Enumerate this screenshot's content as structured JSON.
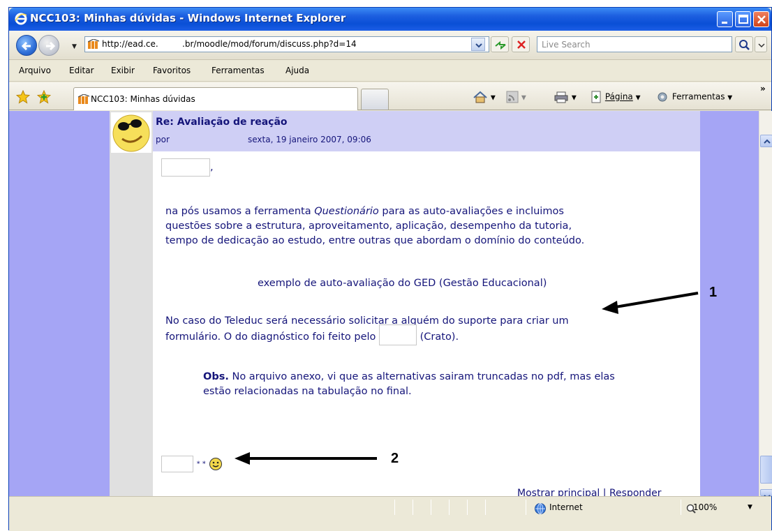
{
  "window": {
    "title": "NCC103: Minhas dúvidas - Windows Internet Explorer"
  },
  "address_bar": {
    "url": "http://ead.ce.         .br/moodle/mod/forum/discuss.php?d=14",
    "search_placeholder": "Live Search"
  },
  "menu": {
    "items": [
      "Arquivo",
      "Editar",
      "Exibir",
      "Favoritos",
      "Ferramentas",
      "Ajuda"
    ]
  },
  "tabs": {
    "active_tab": "NCC103: Minhas dúvidas",
    "page_label": "Página",
    "tools_label": "Ferramentas"
  },
  "post": {
    "subject": "Re: Avaliação de reação",
    "by_prefix": "por",
    "date": "sexta, 19 janeiro 2007, 09:06",
    "greeting_suffix": ",",
    "para1_a": "na pós usamos a ferramenta ",
    "para1_em": "Questionário",
    "para1_b": " para as auto-avaliações e incluimos",
    "para1_line2": "questões sobre a estrutura, aproveitamento, aplicação, desempenho da tutoria,",
    "para1_line3": "tempo de dedicação ao estudo, entre outras que abordam o domínio do conteúdo.",
    "link": "exemplo de auto-avaliação do GED (Gestão Educacional)",
    "para2_line1": "No caso do Teleduc será necessário solicitar a alguém do suporte para criar um",
    "para2_line2a": "formulário. O do diagnóstico foi feito pelo ",
    "para2_line2b": " (Crato).",
    "obs_label": "Obs.",
    "obs_line1": " No arquivo anexo, vi que as alternativas sairam truncadas no pdf, mas elas",
    "obs_line2": "estão relacionadas na tabulação no final.",
    "signature_stars": "* *",
    "link_show_parent": "Mostrar principal",
    "separator": "|",
    "link_reply": "Responder"
  },
  "status": {
    "zone": "Internet",
    "zoom": "100%"
  },
  "annotations": {
    "label1": "1",
    "label2": "2"
  }
}
